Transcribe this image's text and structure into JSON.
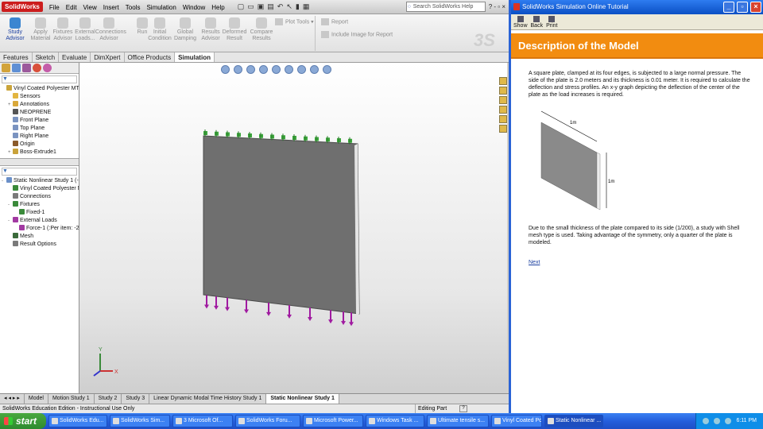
{
  "solidworks": {
    "logo": "SolidWorks",
    "menu": [
      "File",
      "Edit",
      "View",
      "Insert",
      "Tools",
      "Simulation",
      "Window",
      "Help"
    ],
    "search_placeholder": "Search SolidWorks Help",
    "win_controls": "? - ▫ ×",
    "command_manager": [
      {
        "label": "Study\nAdvisor",
        "enabled": true
      },
      {
        "label": "Apply\nMaterial",
        "enabled": false
      },
      {
        "label": "Fixtures\nAdvisor",
        "enabled": false
      },
      {
        "label": "External\nLoads...",
        "enabled": false
      },
      {
        "label": "Connections\nAdvisor",
        "enabled": false
      },
      {
        "label": "Run",
        "enabled": false
      },
      {
        "label": "Initial\nCondition",
        "enabled": false
      },
      {
        "label": "Global\nDamping",
        "enabled": false
      },
      {
        "label": "Results\nAdvisor",
        "enabled": false
      },
      {
        "label": "Deformed\nResult",
        "enabled": false
      },
      {
        "label": "Compare\nResults",
        "enabled": false
      }
    ],
    "plot_tools": "Plot Tools",
    "report": "Report",
    "include_image": "Include Image for Report",
    "tabs": [
      "Features",
      "Sketch",
      "Evaluate",
      "DimXpert",
      "Office Products",
      "Simulation"
    ],
    "active_tab": "Simulation",
    "tree_top": [
      {
        "label": "Vinyl Coated Polyester MTS",
        "level": 0,
        "expand": "",
        "color": "#caa43a"
      },
      {
        "label": "Sensors",
        "level": 1,
        "expand": "",
        "color": "#e2b540"
      },
      {
        "label": "Annotations",
        "level": 1,
        "expand": "+",
        "color": "#d9a83a"
      },
      {
        "label": "NEOPRENE",
        "level": 1,
        "expand": "",
        "color": "#555"
      },
      {
        "label": "Front Plane",
        "level": 1,
        "expand": "",
        "color": "#7a93c0"
      },
      {
        "label": "Top Plane",
        "level": 1,
        "expand": "",
        "color": "#7a93c0"
      },
      {
        "label": "Right Plane",
        "level": 1,
        "expand": "",
        "color": "#7a93c0"
      },
      {
        "label": "Origin",
        "level": 1,
        "expand": "",
        "color": "#8a5a2a"
      },
      {
        "label": "Boss-Extrude1",
        "level": 1,
        "expand": "+",
        "color": "#c9a23a"
      }
    ],
    "tree_sim": [
      {
        "label": "Static Nonlinear Study 1 (-De",
        "level": 0,
        "expand": "-",
        "color": "#6a8fc8"
      },
      {
        "label": "Vinyl Coated Polyester MT",
        "level": 1,
        "expand": "",
        "color": "#3a8a3a"
      },
      {
        "label": "Connections",
        "level": 1,
        "expand": "",
        "color": "#7a7a7a"
      },
      {
        "label": "Fixtures",
        "level": 1,
        "expand": "-",
        "color": "#3a8a3a"
      },
      {
        "label": "Fixed-1",
        "level": 2,
        "expand": "",
        "color": "#3a8a3a"
      },
      {
        "label": "External Loads",
        "level": 1,
        "expand": "-",
        "color": "#a23aa2"
      },
      {
        "label": "Force-1 (:Per item: -2(",
        "level": 2,
        "expand": "",
        "color": "#a23aa2"
      },
      {
        "label": "Mesh",
        "level": 1,
        "expand": "",
        "color": "#3a6a3a"
      },
      {
        "label": "Result Options",
        "level": 1,
        "expand": "",
        "color": "#7a7a7a"
      }
    ],
    "bottom_tabs": [
      "Model",
      "Motion Study 1",
      "Study 2",
      "Study 3",
      "Linear Dynamic Modal Time History Study 1",
      "Static Nonlinear Study 1"
    ],
    "active_bottom_tab": "Static Nonlinear Study 1",
    "status": "SolidWorks Education Edition - Instructional Use Only",
    "status_mode": "Editing Part",
    "status_help": "?"
  },
  "tutorial": {
    "window_title": "SolidWorks Simulation Online Tutorial",
    "toolbar": [
      "Show",
      "Back",
      "Print"
    ],
    "heading": "Description of the Model",
    "para1": "A square plate, clamped at its four edges, is subjected to a large normal pressure. The side of the plate is 2.0 meters and its thickness is 0.01 meter. It is required to calculate the deflection and stress profiles. An x-y graph depicting the deflection of the center of the plate as the load increases is required.",
    "dim_top": "1m",
    "dim_side": "1m",
    "para2": "Due to the small thickness of the plate compared to its side (1/200), a study with Shell mesh type is used. Taking advantage of the symmetry, only a quarter of the plate is modeled.",
    "next": "Next"
  },
  "taskbar": {
    "start": "start",
    "items": [
      "SolidWorks Edu...",
      "SolidWorks Sim...",
      "3 Microsoft Of...",
      "SolidWorks Foru...",
      "Microsoft Power...",
      "Windows Task ...",
      "Ultimate tensile s...",
      "Vinyl Coated Pol...",
      "Static Nonlinear ..."
    ],
    "active_index": 8,
    "clock": "6:11 PM"
  },
  "colors": {
    "accent_orange": "#f28c10",
    "xp_blue": "#245edc",
    "plate_gray": "#6e6e6e",
    "fixture_green": "#3ca63c",
    "load_purple": "#a01aa0"
  }
}
